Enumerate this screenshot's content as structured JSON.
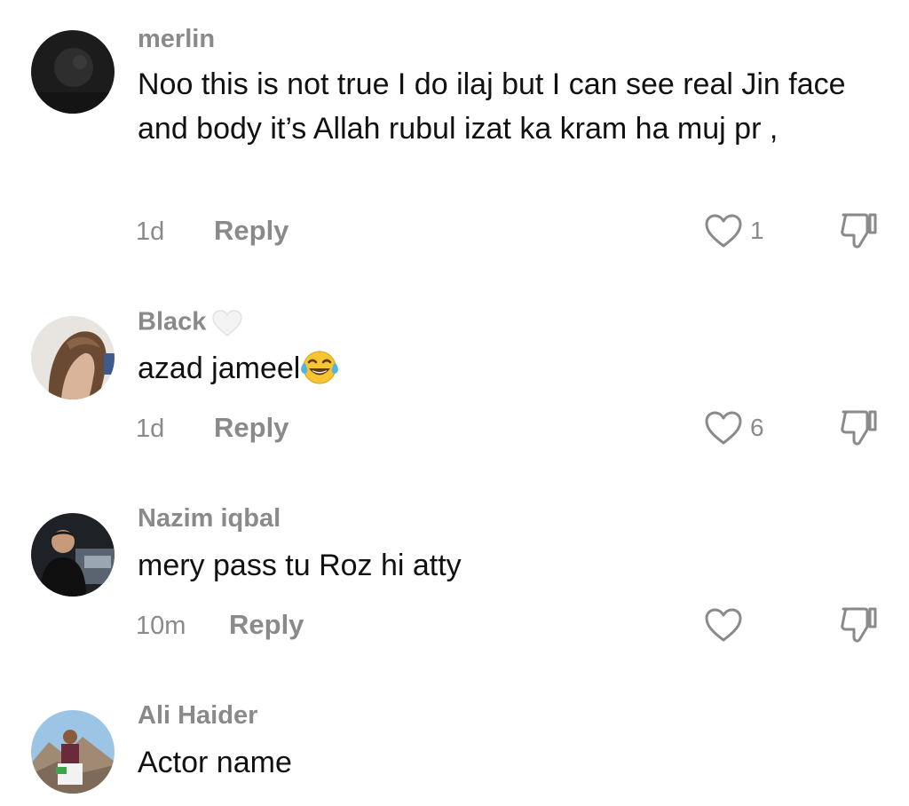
{
  "comments": [
    {
      "username": "merlin",
      "text": "Noo this is not true I do ilaj but I can see real Jin face and body it’s Allah rubul izat ka kram ha muj pr ,",
      "time": "1d",
      "reply_label": "Reply",
      "likes": "1",
      "avatar": "dark-avatar"
    },
    {
      "username": "Black",
      "username_emoji": "white-heart-icon",
      "text": "azad jameel",
      "text_emoji": "tears-of-joy-emoji",
      "time": "1d",
      "reply_label": "Reply",
      "likes": "6",
      "avatar": "woman-long-hair-avatar"
    },
    {
      "username": "Nazim iqbal",
      "text": "mery pass tu Roz hi atty",
      "time": "10m",
      "reply_label": "Reply",
      "likes": "",
      "avatar": "man-avatar"
    },
    {
      "username": "Ali Haider",
      "text": "Actor name",
      "time": "",
      "reply_label": "",
      "likes": "",
      "avatar": "mountain-avatar"
    }
  ],
  "colors": {
    "text": "#111111",
    "muted": "#8a8a8a",
    "background": "#ffffff"
  }
}
